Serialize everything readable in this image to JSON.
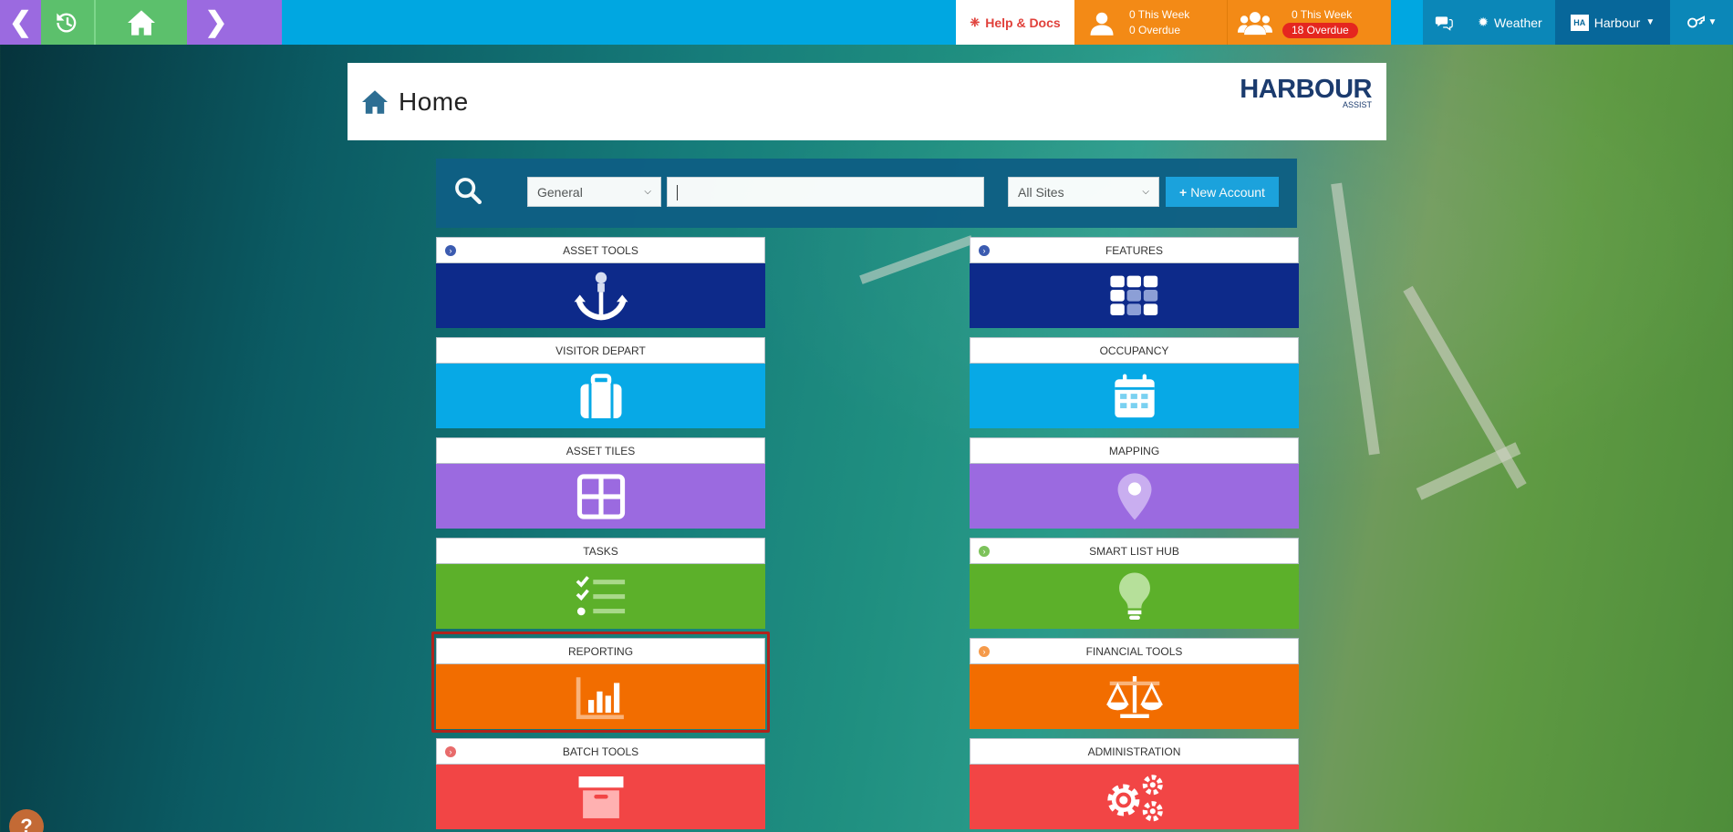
{
  "topbar": {
    "help_label": "Help & Docs",
    "personal": {
      "this_week": "0 This Week",
      "overdue": "0 Overdue"
    },
    "team": {
      "this_week": "0 This Week",
      "overdue": "18 Overdue"
    },
    "weather_label": "Weather",
    "harbour_label": "Harbour",
    "harbour_logo_text": "HA",
    "colors": {
      "bar": "#00a7e1",
      "back": "#9b6ae0",
      "history": "#5cc06c",
      "counts": "#f38a16",
      "overdue": "#e5261f"
    }
  },
  "header": {
    "title": "Home",
    "brand_name": "HARBOUR",
    "brand_sub": "ASSIST"
  },
  "search": {
    "category_value": "General",
    "query_value": "",
    "sites_value": "All Sites",
    "new_account_label": "New Account"
  },
  "tiles": {
    "left": [
      {
        "label": "ASSET TOOLS",
        "icon": "anchor-icon",
        "color": "#0d2a8a",
        "dot": "blue"
      },
      {
        "label": "VISITOR DEPART",
        "icon": "suitcase-icon",
        "color": "#07a9e6"
      },
      {
        "label": "ASSET TILES",
        "icon": "grid-icon",
        "color": "#9b6ae0"
      },
      {
        "label": "TASKS",
        "icon": "checklist-icon",
        "color": "#5cb02a"
      },
      {
        "label": "REPORTING",
        "icon": "bar-chart-icon",
        "color": "#f26d00"
      },
      {
        "label": "BATCH TOOLS",
        "icon": "archive-box-icon",
        "color": "#f24545",
        "dot": "red"
      }
    ],
    "right": [
      {
        "label": "FEATURES",
        "icon": "apps-grid-icon",
        "color": "#0d2a8a",
        "dot": "blue"
      },
      {
        "label": "OCCUPANCY",
        "icon": "calendar-icon",
        "color": "#07a9e6"
      },
      {
        "label": "MAPPING",
        "icon": "map-pin-icon",
        "color": "#9b6ae0"
      },
      {
        "label": "SMART LIST HUB",
        "icon": "lightbulb-icon",
        "color": "#5cb02a",
        "dot": "green"
      },
      {
        "label": "FINANCIAL TOOLS",
        "icon": "scales-icon",
        "color": "#f26d00",
        "dot": "orange"
      },
      {
        "label": "ADMINISTRATION",
        "icon": "gears-icon",
        "color": "#f24545"
      }
    ]
  },
  "help_bubble": "?"
}
